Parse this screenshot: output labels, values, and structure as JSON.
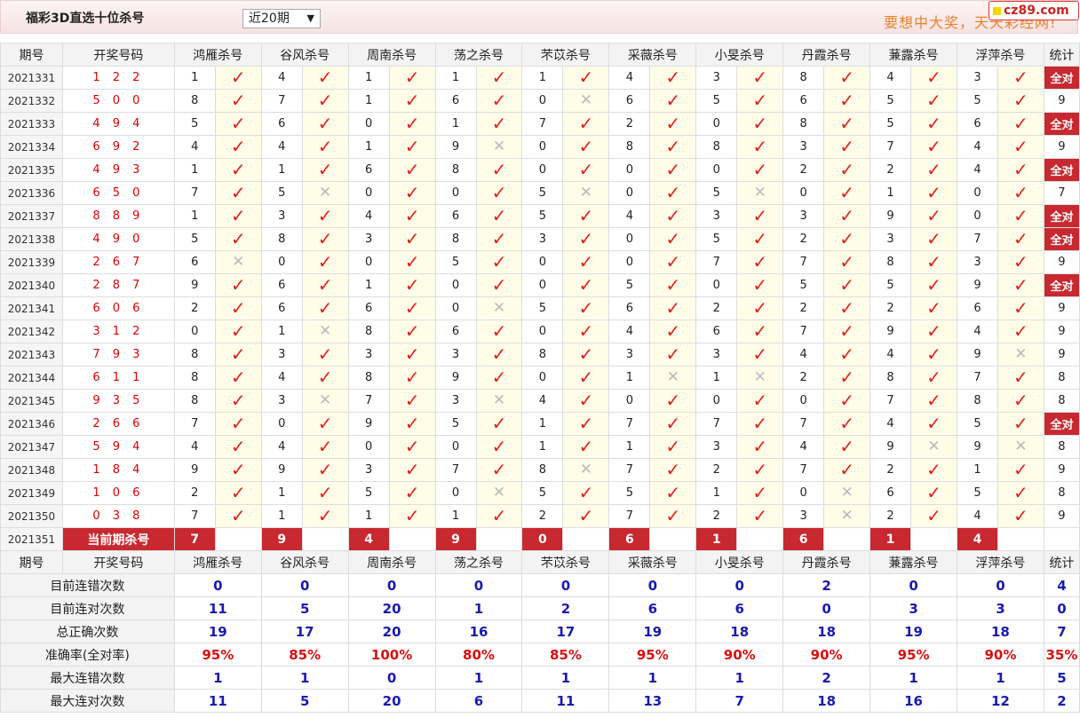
{
  "header": {
    "title": "福彩3D直选十位杀号",
    "period_select": "近20期",
    "slogan": "要想中大奖，天天彩经网!",
    "logo": "cz89.com"
  },
  "columns": {
    "period": "期号",
    "winning": "开奖号码",
    "experts": [
      "鸿雁杀号",
      "谷风杀号",
      "周南杀号",
      "荡之杀号",
      "芣苡杀号",
      "采薇杀号",
      "小旻杀号",
      "丹霞杀号",
      "蒹露杀号",
      "浮萍杀号"
    ],
    "stats": "统计"
  },
  "all_correct_label": "全对",
  "rows": [
    {
      "period": "2021331",
      "winning": "1 2 2",
      "picks": [
        [
          "1",
          1
        ],
        [
          "4",
          1
        ],
        [
          "1",
          1
        ],
        [
          "1",
          1
        ],
        [
          "1",
          1
        ],
        [
          "4",
          1
        ],
        [
          "3",
          1
        ],
        [
          "8",
          1
        ],
        [
          "4",
          1
        ],
        [
          "3",
          1
        ]
      ],
      "stat": "全对"
    },
    {
      "period": "2021332",
      "winning": "5 0 0",
      "picks": [
        [
          "8",
          1
        ],
        [
          "7",
          1
        ],
        [
          "1",
          1
        ],
        [
          "6",
          1
        ],
        [
          "0",
          0
        ],
        [
          "6",
          1
        ],
        [
          "5",
          1
        ],
        [
          "6",
          1
        ],
        [
          "5",
          1
        ],
        [
          "5",
          1
        ]
      ],
      "stat": "9"
    },
    {
      "period": "2021333",
      "winning": "4 9 4",
      "picks": [
        [
          "5",
          1
        ],
        [
          "6",
          1
        ],
        [
          "0",
          1
        ],
        [
          "1",
          1
        ],
        [
          "7",
          1
        ],
        [
          "2",
          1
        ],
        [
          "0",
          1
        ],
        [
          "8",
          1
        ],
        [
          "5",
          1
        ],
        [
          "6",
          1
        ]
      ],
      "stat": "全对"
    },
    {
      "period": "2021334",
      "winning": "6 9 2",
      "picks": [
        [
          "4",
          1
        ],
        [
          "4",
          1
        ],
        [
          "1",
          1
        ],
        [
          "9",
          0
        ],
        [
          "0",
          1
        ],
        [
          "8",
          1
        ],
        [
          "8",
          1
        ],
        [
          "3",
          1
        ],
        [
          "7",
          1
        ],
        [
          "4",
          1
        ]
      ],
      "stat": "9"
    },
    {
      "period": "2021335",
      "winning": "4 9 3",
      "picks": [
        [
          "1",
          1
        ],
        [
          "1",
          1
        ],
        [
          "6",
          1
        ],
        [
          "8",
          1
        ],
        [
          "0",
          1
        ],
        [
          "0",
          1
        ],
        [
          "0",
          1
        ],
        [
          "2",
          1
        ],
        [
          "2",
          1
        ],
        [
          "4",
          1
        ]
      ],
      "stat": "全对"
    },
    {
      "period": "2021336",
      "winning": "6 5 0",
      "picks": [
        [
          "7",
          1
        ],
        [
          "5",
          0
        ],
        [
          "0",
          1
        ],
        [
          "0",
          1
        ],
        [
          "5",
          0
        ],
        [
          "0",
          1
        ],
        [
          "5",
          0
        ],
        [
          "0",
          1
        ],
        [
          "1",
          1
        ],
        [
          "0",
          1
        ]
      ],
      "stat": "7"
    },
    {
      "period": "2021337",
      "winning": "8 8 9",
      "picks": [
        [
          "1",
          1
        ],
        [
          "3",
          1
        ],
        [
          "4",
          1
        ],
        [
          "6",
          1
        ],
        [
          "5",
          1
        ],
        [
          "4",
          1
        ],
        [
          "3",
          1
        ],
        [
          "3",
          1
        ],
        [
          "9",
          1
        ],
        [
          "0",
          1
        ]
      ],
      "stat": "全对"
    },
    {
      "period": "2021338",
      "winning": "4 9 0",
      "picks": [
        [
          "5",
          1
        ],
        [
          "8",
          1
        ],
        [
          "3",
          1
        ],
        [
          "8",
          1
        ],
        [
          "3",
          1
        ],
        [
          "0",
          1
        ],
        [
          "5",
          1
        ],
        [
          "2",
          1
        ],
        [
          "3",
          1
        ],
        [
          "7",
          1
        ]
      ],
      "stat": "全对"
    },
    {
      "period": "2021339",
      "winning": "2 6 7",
      "picks": [
        [
          "6",
          0
        ],
        [
          "0",
          1
        ],
        [
          "0",
          1
        ],
        [
          "5",
          1
        ],
        [
          "0",
          1
        ],
        [
          "0",
          1
        ],
        [
          "7",
          1
        ],
        [
          "7",
          1
        ],
        [
          "8",
          1
        ],
        [
          "3",
          1
        ]
      ],
      "stat": "9"
    },
    {
      "period": "2021340",
      "winning": "2 8 7",
      "picks": [
        [
          "9",
          1
        ],
        [
          "6",
          1
        ],
        [
          "1",
          1
        ],
        [
          "0",
          1
        ],
        [
          "0",
          1
        ],
        [
          "5",
          1
        ],
        [
          "0",
          1
        ],
        [
          "5",
          1
        ],
        [
          "5",
          1
        ],
        [
          "9",
          1
        ]
      ],
      "stat": "全对"
    },
    {
      "period": "2021341",
      "winning": "6 0 6",
      "picks": [
        [
          "2",
          1
        ],
        [
          "6",
          1
        ],
        [
          "6",
          1
        ],
        [
          "0",
          0
        ],
        [
          "5",
          1
        ],
        [
          "6",
          1
        ],
        [
          "2",
          1
        ],
        [
          "2",
          1
        ],
        [
          "2",
          1
        ],
        [
          "6",
          1
        ]
      ],
      "stat": "9"
    },
    {
      "period": "2021342",
      "winning": "3 1 2",
      "picks": [
        [
          "0",
          1
        ],
        [
          "1",
          0
        ],
        [
          "8",
          1
        ],
        [
          "6",
          1
        ],
        [
          "0",
          1
        ],
        [
          "4",
          1
        ],
        [
          "6",
          1
        ],
        [
          "7",
          1
        ],
        [
          "9",
          1
        ],
        [
          "4",
          1
        ]
      ],
      "stat": "9"
    },
    {
      "period": "2021343",
      "winning": "7 9 3",
      "picks": [
        [
          "8",
          1
        ],
        [
          "3",
          1
        ],
        [
          "3",
          1
        ],
        [
          "3",
          1
        ],
        [
          "8",
          1
        ],
        [
          "3",
          1
        ],
        [
          "3",
          1
        ],
        [
          "4",
          1
        ],
        [
          "4",
          1
        ],
        [
          "9",
          0
        ]
      ],
      "stat": "9"
    },
    {
      "period": "2021344",
      "winning": "6 1 1",
      "picks": [
        [
          "8",
          1
        ],
        [
          "4",
          1
        ],
        [
          "8",
          1
        ],
        [
          "9",
          1
        ],
        [
          "0",
          1
        ],
        [
          "1",
          0
        ],
        [
          "1",
          0
        ],
        [
          "2",
          1
        ],
        [
          "8",
          1
        ],
        [
          "7",
          1
        ]
      ],
      "stat": "8"
    },
    {
      "period": "2021345",
      "winning": "9 3 5",
      "picks": [
        [
          "8",
          1
        ],
        [
          "3",
          0
        ],
        [
          "7",
          1
        ],
        [
          "3",
          0
        ],
        [
          "4",
          1
        ],
        [
          "0",
          1
        ],
        [
          "0",
          1
        ],
        [
          "0",
          1
        ],
        [
          "7",
          1
        ],
        [
          "8",
          1
        ]
      ],
      "stat": "8"
    },
    {
      "period": "2021346",
      "winning": "2 6 6",
      "picks": [
        [
          "7",
          1
        ],
        [
          "0",
          1
        ],
        [
          "9",
          1
        ],
        [
          "5",
          1
        ],
        [
          "1",
          1
        ],
        [
          "7",
          1
        ],
        [
          "7",
          1
        ],
        [
          "7",
          1
        ],
        [
          "4",
          1
        ],
        [
          "5",
          1
        ]
      ],
      "stat": "全对"
    },
    {
      "period": "2021347",
      "winning": "5 9 4",
      "picks": [
        [
          "4",
          1
        ],
        [
          "4",
          1
        ],
        [
          "0",
          1
        ],
        [
          "0",
          1
        ],
        [
          "1",
          1
        ],
        [
          "1",
          1
        ],
        [
          "3",
          1
        ],
        [
          "4",
          1
        ],
        [
          "9",
          0
        ],
        [
          "9",
          0
        ]
      ],
      "stat": "8"
    },
    {
      "period": "2021348",
      "winning": "1 8 4",
      "picks": [
        [
          "9",
          1
        ],
        [
          "9",
          1
        ],
        [
          "3",
          1
        ],
        [
          "7",
          1
        ],
        [
          "8",
          0
        ],
        [
          "7",
          1
        ],
        [
          "2",
          1
        ],
        [
          "7",
          1
        ],
        [
          "2",
          1
        ],
        [
          "1",
          1
        ]
      ],
      "stat": "9"
    },
    {
      "period": "2021349",
      "winning": "1 0 6",
      "picks": [
        [
          "2",
          1
        ],
        [
          "1",
          1
        ],
        [
          "5",
          1
        ],
        [
          "0",
          0
        ],
        [
          "5",
          1
        ],
        [
          "5",
          1
        ],
        [
          "1",
          1
        ],
        [
          "0",
          0
        ],
        [
          "6",
          1
        ],
        [
          "5",
          1
        ]
      ],
      "stat": "8"
    },
    {
      "period": "2021350",
      "winning": "0 3 8",
      "picks": [
        [
          "7",
          1
        ],
        [
          "1",
          1
        ],
        [
          "1",
          1
        ],
        [
          "1",
          1
        ],
        [
          "2",
          1
        ],
        [
          "7",
          1
        ],
        [
          "2",
          1
        ],
        [
          "3",
          0
        ],
        [
          "2",
          1
        ],
        [
          "4",
          1
        ]
      ],
      "stat": "9"
    }
  ],
  "current": {
    "period": "2021351",
    "label": "当前期杀号",
    "kills": [
      "7",
      "9",
      "4",
      "9",
      "0",
      "6",
      "1",
      "6",
      "1",
      "4"
    ]
  },
  "summary": [
    {
      "label": "目前连错次数",
      "values": [
        "0",
        "0",
        "0",
        "0",
        "0",
        "0",
        "0",
        "2",
        "0",
        "0"
      ],
      "stat": "4",
      "red": false
    },
    {
      "label": "目前连对次数",
      "values": [
        "11",
        "5",
        "20",
        "1",
        "2",
        "6",
        "6",
        "0",
        "3",
        "3"
      ],
      "stat": "0",
      "red": false
    },
    {
      "label": "总正确次数",
      "values": [
        "19",
        "17",
        "20",
        "16",
        "17",
        "19",
        "18",
        "18",
        "19",
        "18"
      ],
      "stat": "7",
      "red": false
    },
    {
      "label": "准确率(全对率)",
      "values": [
        "95%",
        "85%",
        "100%",
        "80%",
        "85%",
        "95%",
        "90%",
        "90%",
        "95%",
        "90%"
      ],
      "stat": "35%",
      "red": true
    },
    {
      "label": "最大连错次数",
      "values": [
        "1",
        "1",
        "0",
        "1",
        "1",
        "1",
        "1",
        "2",
        "1",
        "1"
      ],
      "stat": "5",
      "red": false
    },
    {
      "label": "最大连对次数",
      "values": [
        "11",
        "5",
        "20",
        "6",
        "11",
        "13",
        "7",
        "18",
        "16",
        "12"
      ],
      "stat": "2",
      "red": false
    }
  ],
  "icons": {
    "correct": "check-icon",
    "wrong": "cross-icon"
  }
}
